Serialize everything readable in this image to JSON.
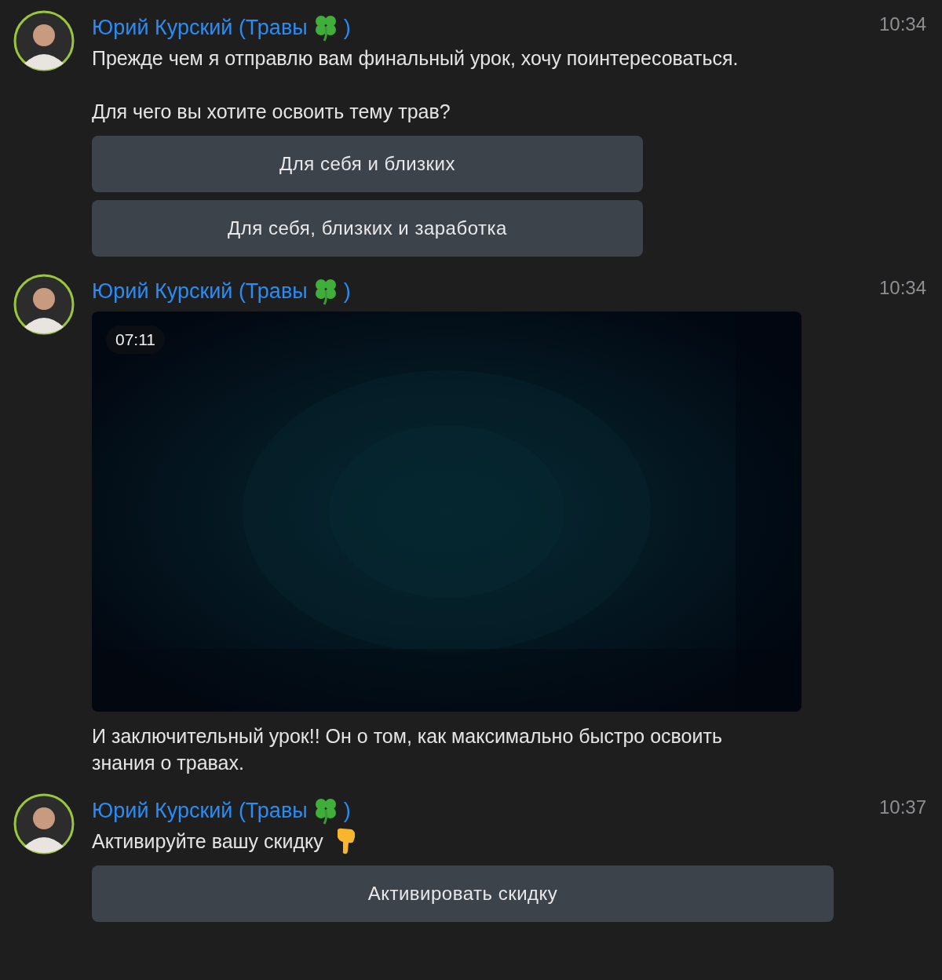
{
  "messages": [
    {
      "author": "Юрий Курский (Травы",
      "author_end": ")",
      "time": "10:34",
      "blocks": [
        {
          "kind": "text",
          "text": "Прежде чем я отправлю вам финальный урок, хочу поинтересоваться."
        },
        {
          "kind": "text",
          "text": "Для чего вы хотите освоить тему трав?"
        },
        {
          "kind": "buttons",
          "buttons": [
            "Для себя и близких",
            "Для себя, близких и заработка"
          ]
        }
      ]
    },
    {
      "author": "Юрий Курский (Травы",
      "author_end": ")",
      "time": "10:34",
      "blocks": [
        {
          "kind": "video",
          "duration": "07:11"
        },
        {
          "kind": "text",
          "text": "И заключительный урок!! Он о том, как максимально быстро освоить знания о травах."
        }
      ]
    },
    {
      "author": "Юрий Курский (Травы",
      "author_end": ")",
      "time": "10:37",
      "blocks": [
        {
          "kind": "pointer-text",
          "text": "Активируйте вашу скидку"
        },
        {
          "kind": "buttons",
          "buttons": [
            "Активировать скидку"
          ]
        }
      ]
    }
  ]
}
